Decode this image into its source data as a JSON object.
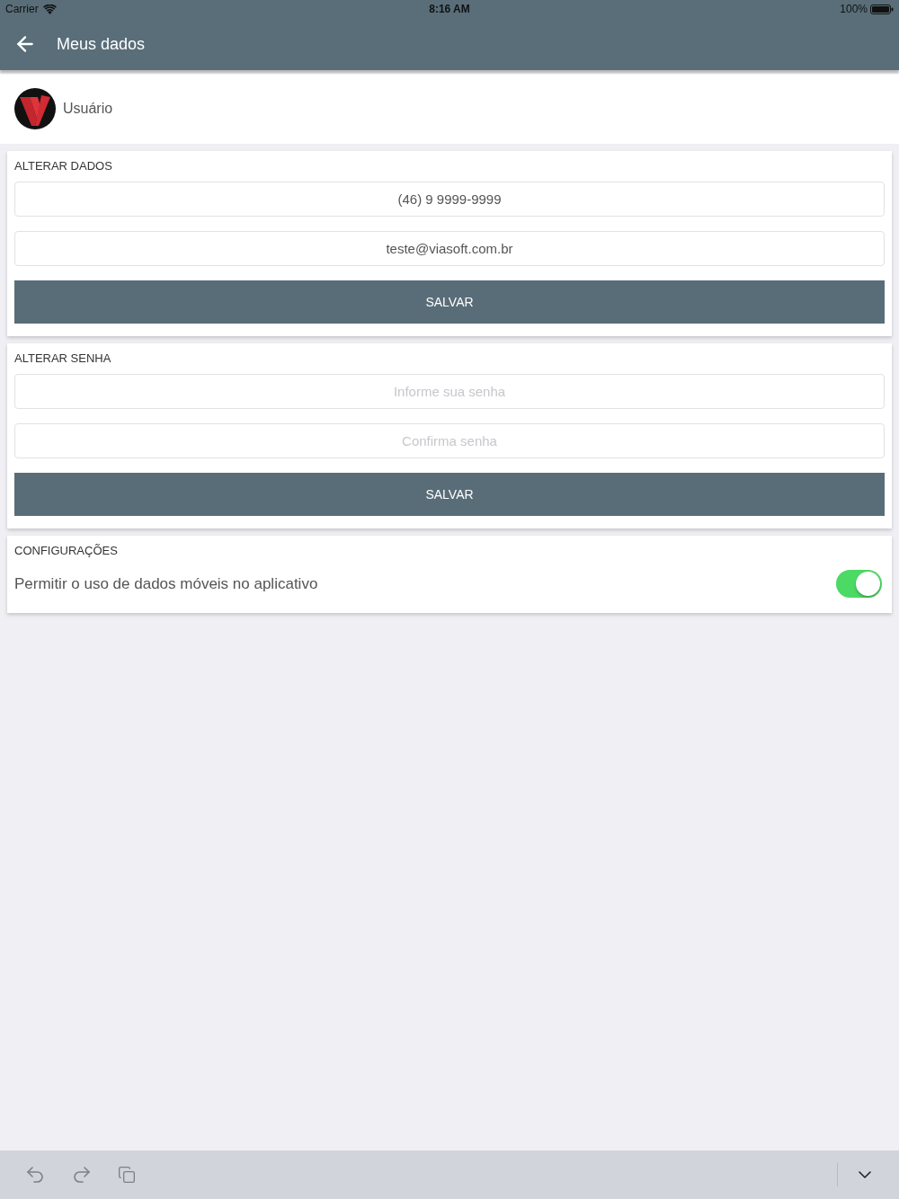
{
  "status_bar": {
    "carrier": "Carrier",
    "time": "8:16 AM",
    "battery": "100%"
  },
  "header": {
    "title": "Meus dados"
  },
  "profile": {
    "name": "Usuário"
  },
  "sections": [
    {
      "kind": "form",
      "title": "ALTERAR DADOS",
      "fields": [
        {
          "value": "(46) 9 9999-9999"
        },
        {
          "value": "teste@viasoft.com.br"
        }
      ],
      "button": "SALVAR"
    },
    {
      "kind": "form",
      "title": "ALTERAR SENHA",
      "fields": [
        {
          "placeholder": "Informe sua senha"
        },
        {
          "placeholder": "Confirma senha"
        }
      ],
      "button": "SALVAR"
    },
    {
      "kind": "settings",
      "title": "CONFIGURAÇÕES",
      "settings": [
        {
          "label": "Permitir o uso de dados móveis no aplicativo",
          "on": true
        }
      ]
    }
  ]
}
